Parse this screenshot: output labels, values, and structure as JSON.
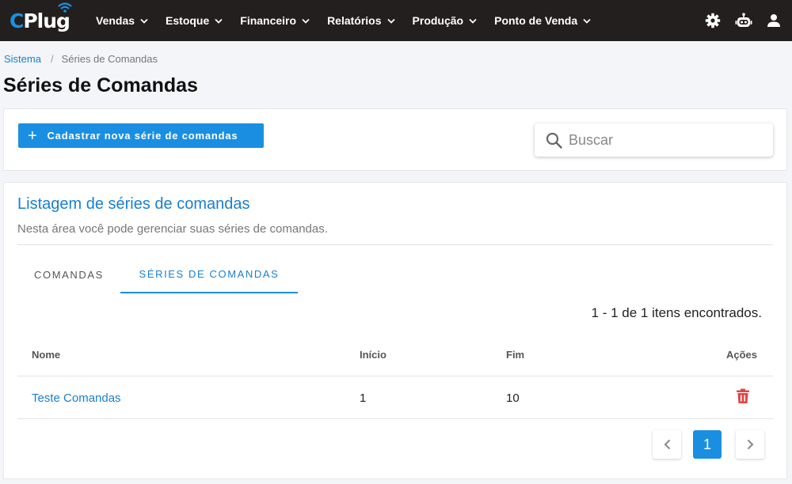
{
  "brand": {
    "logo_c": "C",
    "logo_rest": "Plug",
    "accent": "#1a8fe1"
  },
  "nav": {
    "items": [
      {
        "label": "Vendas"
      },
      {
        "label": "Estoque"
      },
      {
        "label": "Financeiro"
      },
      {
        "label": "Relatórios"
      },
      {
        "label": "Produção"
      },
      {
        "label": "Ponto de Venda"
      }
    ],
    "icons": [
      "gear-icon",
      "robot-icon",
      "user-icon"
    ]
  },
  "breadcrumb": {
    "root": "Sistema",
    "separator": "/",
    "current": "Séries de Comandas"
  },
  "page": {
    "title": "Séries de Comandas"
  },
  "actions": {
    "create_label": "Cadastrar nova série de comandas",
    "create_icon": "+"
  },
  "search": {
    "placeholder": "Buscar",
    "value": ""
  },
  "listing": {
    "title": "Listagem de séries de comandas",
    "subtitle": "Nesta área você pode gerenciar suas séries de comandas.",
    "tabs": [
      {
        "label": "COMANDAS"
      },
      {
        "label": "SÉRIES DE COMANDAS",
        "active": true
      }
    ],
    "count_text": "1 - 1 de 1 itens encontrados.",
    "columns": {
      "name": "Nome",
      "start": "Início",
      "end": "Fim",
      "actions": "Ações"
    },
    "rows": [
      {
        "name": "Teste Comandas",
        "start": "1",
        "end": "10",
        "action_icon": "trash-icon"
      }
    ],
    "pagination": {
      "current": "1",
      "prev_icon": "chevron-left-icon",
      "next_icon": "chevron-right-icon"
    }
  }
}
